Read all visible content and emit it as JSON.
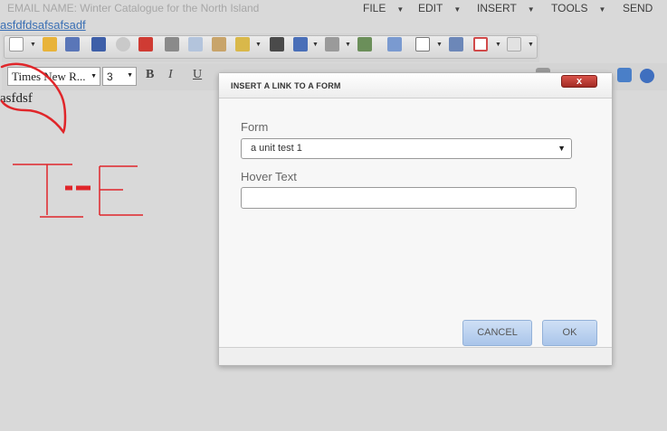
{
  "header": {
    "email_name": "EMAIL NAME: Winter Catalogue for the North Island",
    "menu": [
      "FILE",
      "EDIT",
      "INSERT",
      "TOOLS",
      "SEND"
    ]
  },
  "subject_link": "asfdfdsafsafsadf",
  "toolbar": {
    "font_family": "Times New R...",
    "font_size": "3",
    "bold": "B",
    "italic": "I",
    "underline": "U"
  },
  "editor": {
    "text": "asfdsf",
    "annotation_color": "#e0262a"
  },
  "modal": {
    "title": "INSERT A LINK TO A FORM",
    "close_label": "x",
    "form_label": "Form",
    "form_value": "a unit test 1",
    "hover_label": "Hover Text",
    "hover_value": "",
    "cancel_label": "CANCEL",
    "ok_label": "OK",
    "accent": "#b8d0f0"
  }
}
